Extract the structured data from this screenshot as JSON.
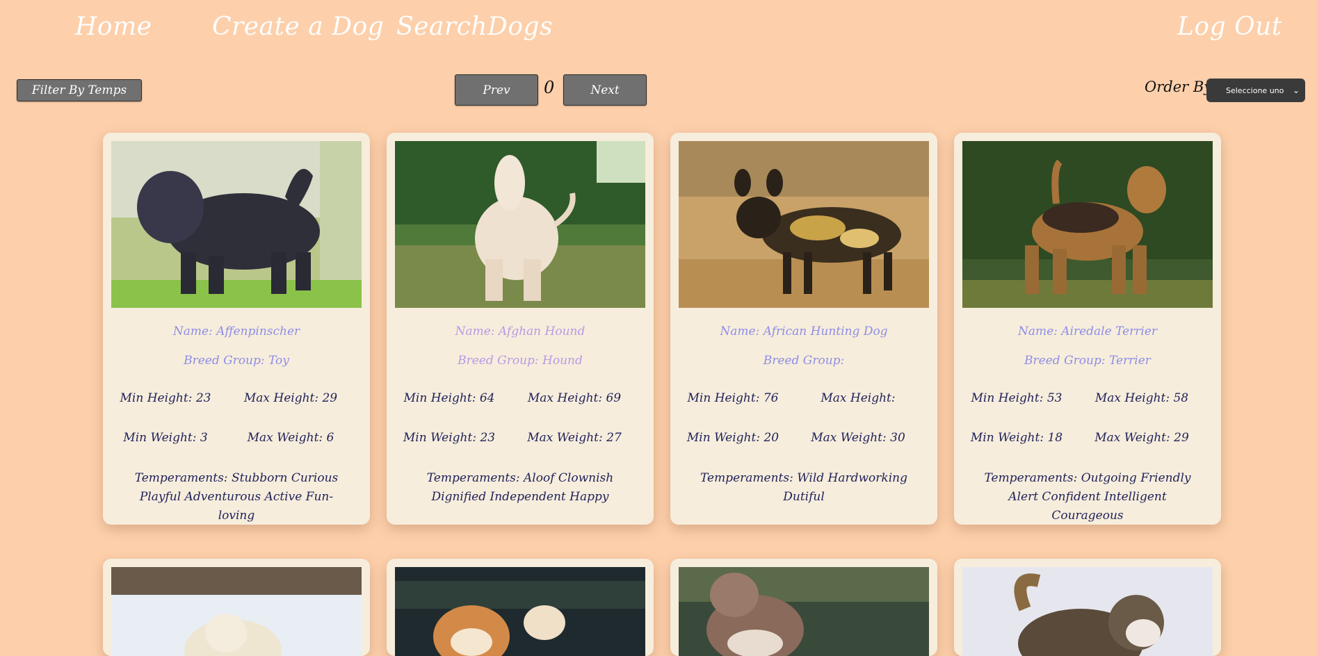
{
  "nav": {
    "home": "Home",
    "create": "Create a Dog",
    "search": "SearchDogs",
    "logout": "Log Out"
  },
  "toolbar": {
    "filter_label": "Filter By Temps",
    "prev_label": "Prev",
    "page": "0",
    "next_label": "Next",
    "order_label": "Order By",
    "order_selected": "Seleccione uno"
  },
  "labels": {
    "name": "Name: ",
    "group": "Breed Group: ",
    "min_height": "Min Height: ",
    "max_height": "Max Height: ",
    "min_weight": "Min Weight: ",
    "max_weight": "Max Weight: ",
    "temps": "Temperaments: "
  },
  "cards": [
    {
      "name": "Name: Affenpinscher",
      "group": "Breed Group: Toy",
      "min_height": "Min Height: 23",
      "max_height": "Max Height: 29",
      "min_weight": "Min Weight: 3",
      "max_weight": "Max Weight: 6",
      "temps": "Temperaments: Stubborn Curious Playful Adventurous Active Fun-loving"
    },
    {
      "name": "Name: Afghan Hound",
      "group": "Breed Group: Hound",
      "min_height": "Min Height: 64",
      "max_height": "Max Height: 69",
      "min_weight": "Min Weight: 23",
      "max_weight": "Max Weight: 27",
      "temps": "Temperaments: Aloof Clownish Dignified Independent Happy"
    },
    {
      "name": "Name: African Hunting Dog",
      "group": "Breed Group:",
      "min_height": "Min Height: 76",
      "max_height": "Max Height:",
      "min_weight": "Min Weight: 20",
      "max_weight": "Max Weight: 30",
      "temps": "Temperaments: Wild Hardworking Dutiful"
    },
    {
      "name": "Name: Airedale Terrier",
      "group": "Breed Group: Terrier",
      "min_height": "Min Height: 53",
      "max_height": "Max Height: 58",
      "min_weight": "Min Weight: 18",
      "max_weight": "Max Weight: 29",
      "temps": "Temperaments: Outgoing Friendly Alert Confident Intelligent Courageous"
    }
  ],
  "colors": {
    "background": "#fdd0ab",
    "card": "#f6eddc",
    "name_text": "#8f8de6",
    "stat_text": "#1f2159",
    "button": "#707070"
  }
}
